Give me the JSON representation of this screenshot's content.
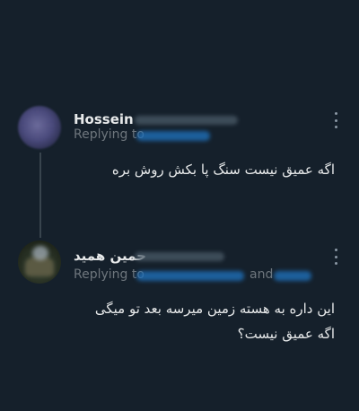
{
  "tweets": [
    {
      "name": "Hossein",
      "replying_to_label": "Replying to",
      "text": "اگه عمیق نیست سنگ پا بکش روش بره"
    },
    {
      "name": "حمین همید",
      "replying_to_label": "Replying to",
      "and_label": "and",
      "text": "این داره به هسته زمین میرسه بعد تو میگی اگه عمیق نیست؟"
    }
  ],
  "colors": {
    "background": "#15202b",
    "text": "#e7e9ea",
    "secondary": "#6e767d",
    "link": "#1d9bf0",
    "thread_line": "#38444d"
  }
}
